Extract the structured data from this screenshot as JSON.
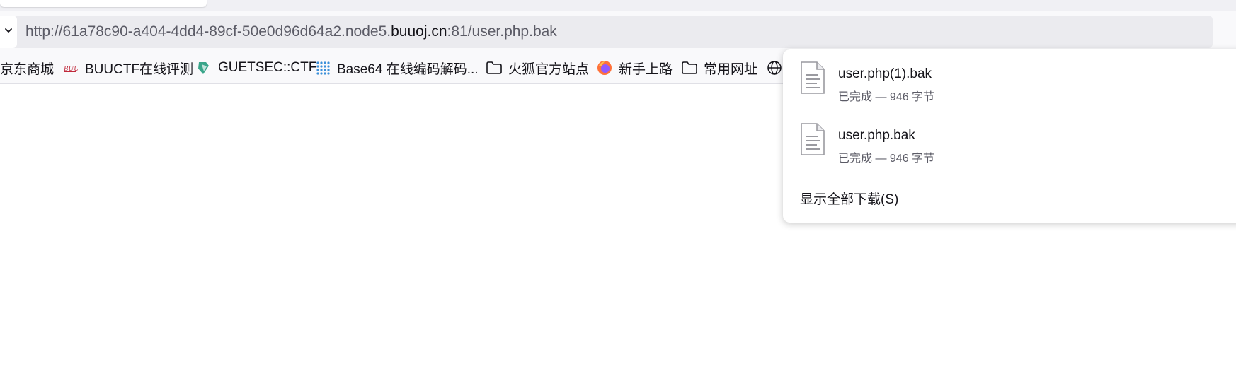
{
  "url": {
    "prefix": "http://61a78c90-a404-4dd4-89cf-50e0d96d64a2.node5.",
    "domain": "buuoj.cn",
    "suffix": ":81/user.php.bak",
    "dropmarker_icon": "chevron-down-icon"
  },
  "bookmarks": [
    {
      "label": "京东商城",
      "icon": "none"
    },
    {
      "label": "BUUCTF在线评测",
      "icon": "buuctf-favicon"
    },
    {
      "label": "GUETSEC::CTF",
      "icon": "guetsec-favicon"
    },
    {
      "label": "Base64 在线编码解码...",
      "icon": "base64-favicon"
    },
    {
      "label": "火狐官方站点",
      "icon": "folder-icon"
    },
    {
      "label": "新手上路",
      "icon": "firefox-icon"
    },
    {
      "label": "常用网址",
      "icon": "folder-icon"
    },
    {
      "label": "",
      "icon": "globe-icon"
    }
  ],
  "downloads": {
    "items": [
      {
        "name": "user.php(1).bak",
        "status": "已完成 — 946 字节",
        "icon": "file-icon"
      },
      {
        "name": "user.php.bak",
        "status": "已完成 — 946 字节",
        "icon": "file-icon"
      }
    ],
    "show_all_label": "显示全部下载(S)"
  },
  "colors": {
    "url_text": "#5b5b66",
    "url_domain": "#15141a",
    "firefox_orange": "#ff7139",
    "firefox_purple": "#9059ff"
  }
}
